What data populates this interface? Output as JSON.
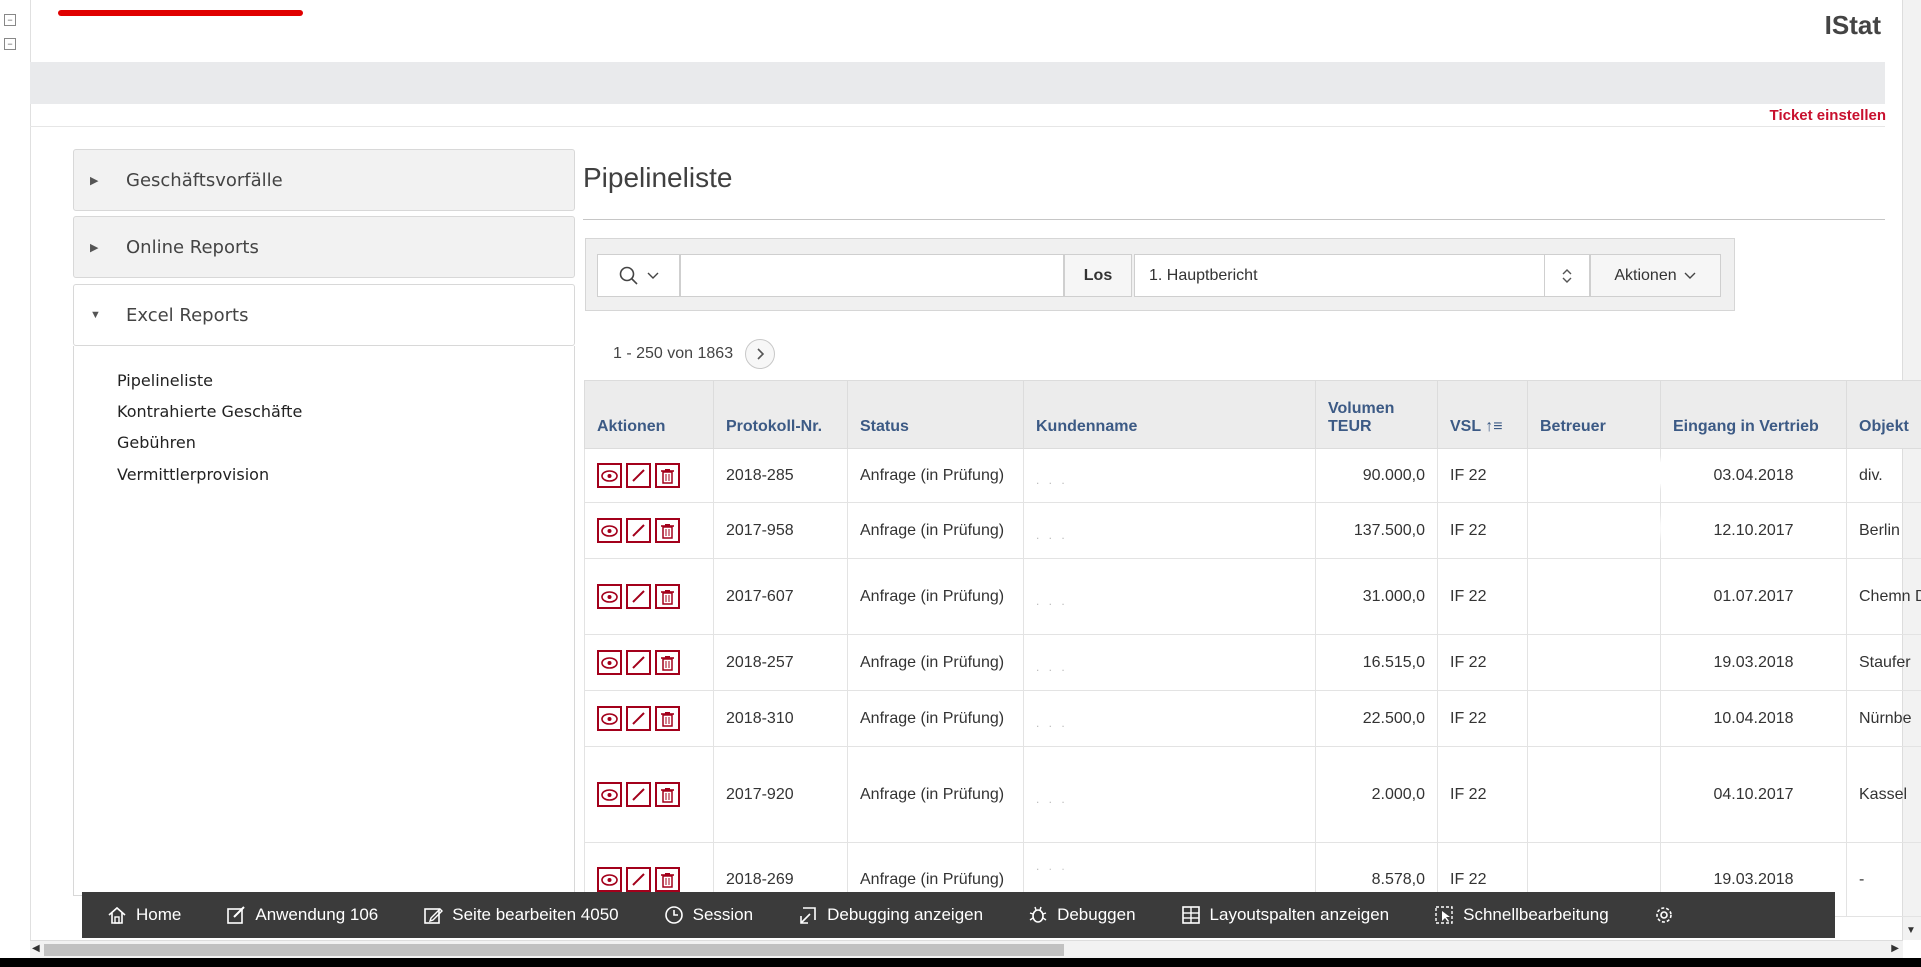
{
  "app": {
    "title": "IStat"
  },
  "header": {
    "ticket_link": "Ticket einstellen"
  },
  "colors": {
    "accent": "#c8102e",
    "action_icon": "#a3001b",
    "table_header_text": "#3c5a85",
    "devbar_bg": "#3b3b3b"
  },
  "sidebar": {
    "sections": [
      {
        "label": "Geschäftsvorfälle",
        "expanded": false
      },
      {
        "label": "Online Reports",
        "expanded": false
      },
      {
        "label": "Excel Reports",
        "expanded": true
      }
    ],
    "links": [
      "Pipelineliste",
      "Kontrahierte Geschäfte",
      "Gebühren",
      "Vermittlerprovision"
    ]
  },
  "main": {
    "heading": "Pipelineliste",
    "toolbar": {
      "search_value": "",
      "go_label": "Los",
      "report_selected": "1. Hauptbericht",
      "actions_label": "Aktionen"
    },
    "pagination": {
      "range": "1 - 250 von 1863"
    }
  },
  "table": {
    "columns": [
      "Aktionen",
      "Protokoll-Nr.",
      "Status",
      "Kundenname",
      "Volumen TEUR",
      "VSL",
      "Betreuer",
      "Eingang in Vertrieb",
      "Objekt"
    ],
    "rows": [
      {
        "protokoll": "2018-285",
        "status": "Anfrage (in Prüfung)",
        "volumen": "90.000,0",
        "vsl": "IF 22",
        "eingang": "03.04.2018",
        "objekt": "div."
      },
      {
        "protokoll": "2017-958",
        "status": "Anfrage (in Prüfung)",
        "volumen": "137.500,0",
        "vsl": "IF 22",
        "eingang": "12.10.2017",
        "objekt": "Berlin"
      },
      {
        "protokoll": "2017-607",
        "status": "Anfrage (in Prüfung)",
        "volumen": "31.000,0",
        "vsl": "IF 22",
        "eingang": "01.07.2017",
        "objekt": "Chemn Dresde"
      },
      {
        "protokoll": "2018-257",
        "status": "Anfrage (in Prüfung)",
        "volumen": "16.515,0",
        "vsl": "IF 22",
        "eingang": "19.03.2018",
        "objekt": "Staufer"
      },
      {
        "protokoll": "2018-310",
        "status": "Anfrage (in Prüfung)",
        "volumen": "22.500,0",
        "vsl": "IF 22",
        "eingang": "10.04.2018",
        "objekt": "Nürnbe"
      },
      {
        "protokoll": "2017-920",
        "status": "Anfrage (in Prüfung)",
        "volumen": "2.000,0",
        "vsl": "IF 22",
        "eingang": "04.10.2017",
        "objekt": "Kassel"
      },
      {
        "protokoll": "2018-269",
        "status": "Anfrage (in Prüfung)",
        "volumen": "8.578,0",
        "vsl": "IF 22",
        "eingang": "19.03.2018",
        "objekt": "-"
      }
    ]
  },
  "dev_bar": {
    "items": [
      {
        "icon": "home-icon",
        "label": "Home"
      },
      {
        "icon": "edit-app-icon",
        "label": "Anwendung 106"
      },
      {
        "icon": "edit-page-icon",
        "label": "Seite bearbeiten 4050"
      },
      {
        "icon": "clock-icon",
        "label": "Session"
      },
      {
        "icon": "debug-view-icon",
        "label": "Debugging anzeigen"
      },
      {
        "icon": "bug-icon",
        "label": "Debuggen"
      },
      {
        "icon": "grid-icon",
        "label": "Layoutspalten anzeigen"
      },
      {
        "icon": "quick-edit-icon",
        "label": "Schnellbearbeitung"
      },
      {
        "icon": "gear-icon",
        "label": ""
      }
    ]
  }
}
